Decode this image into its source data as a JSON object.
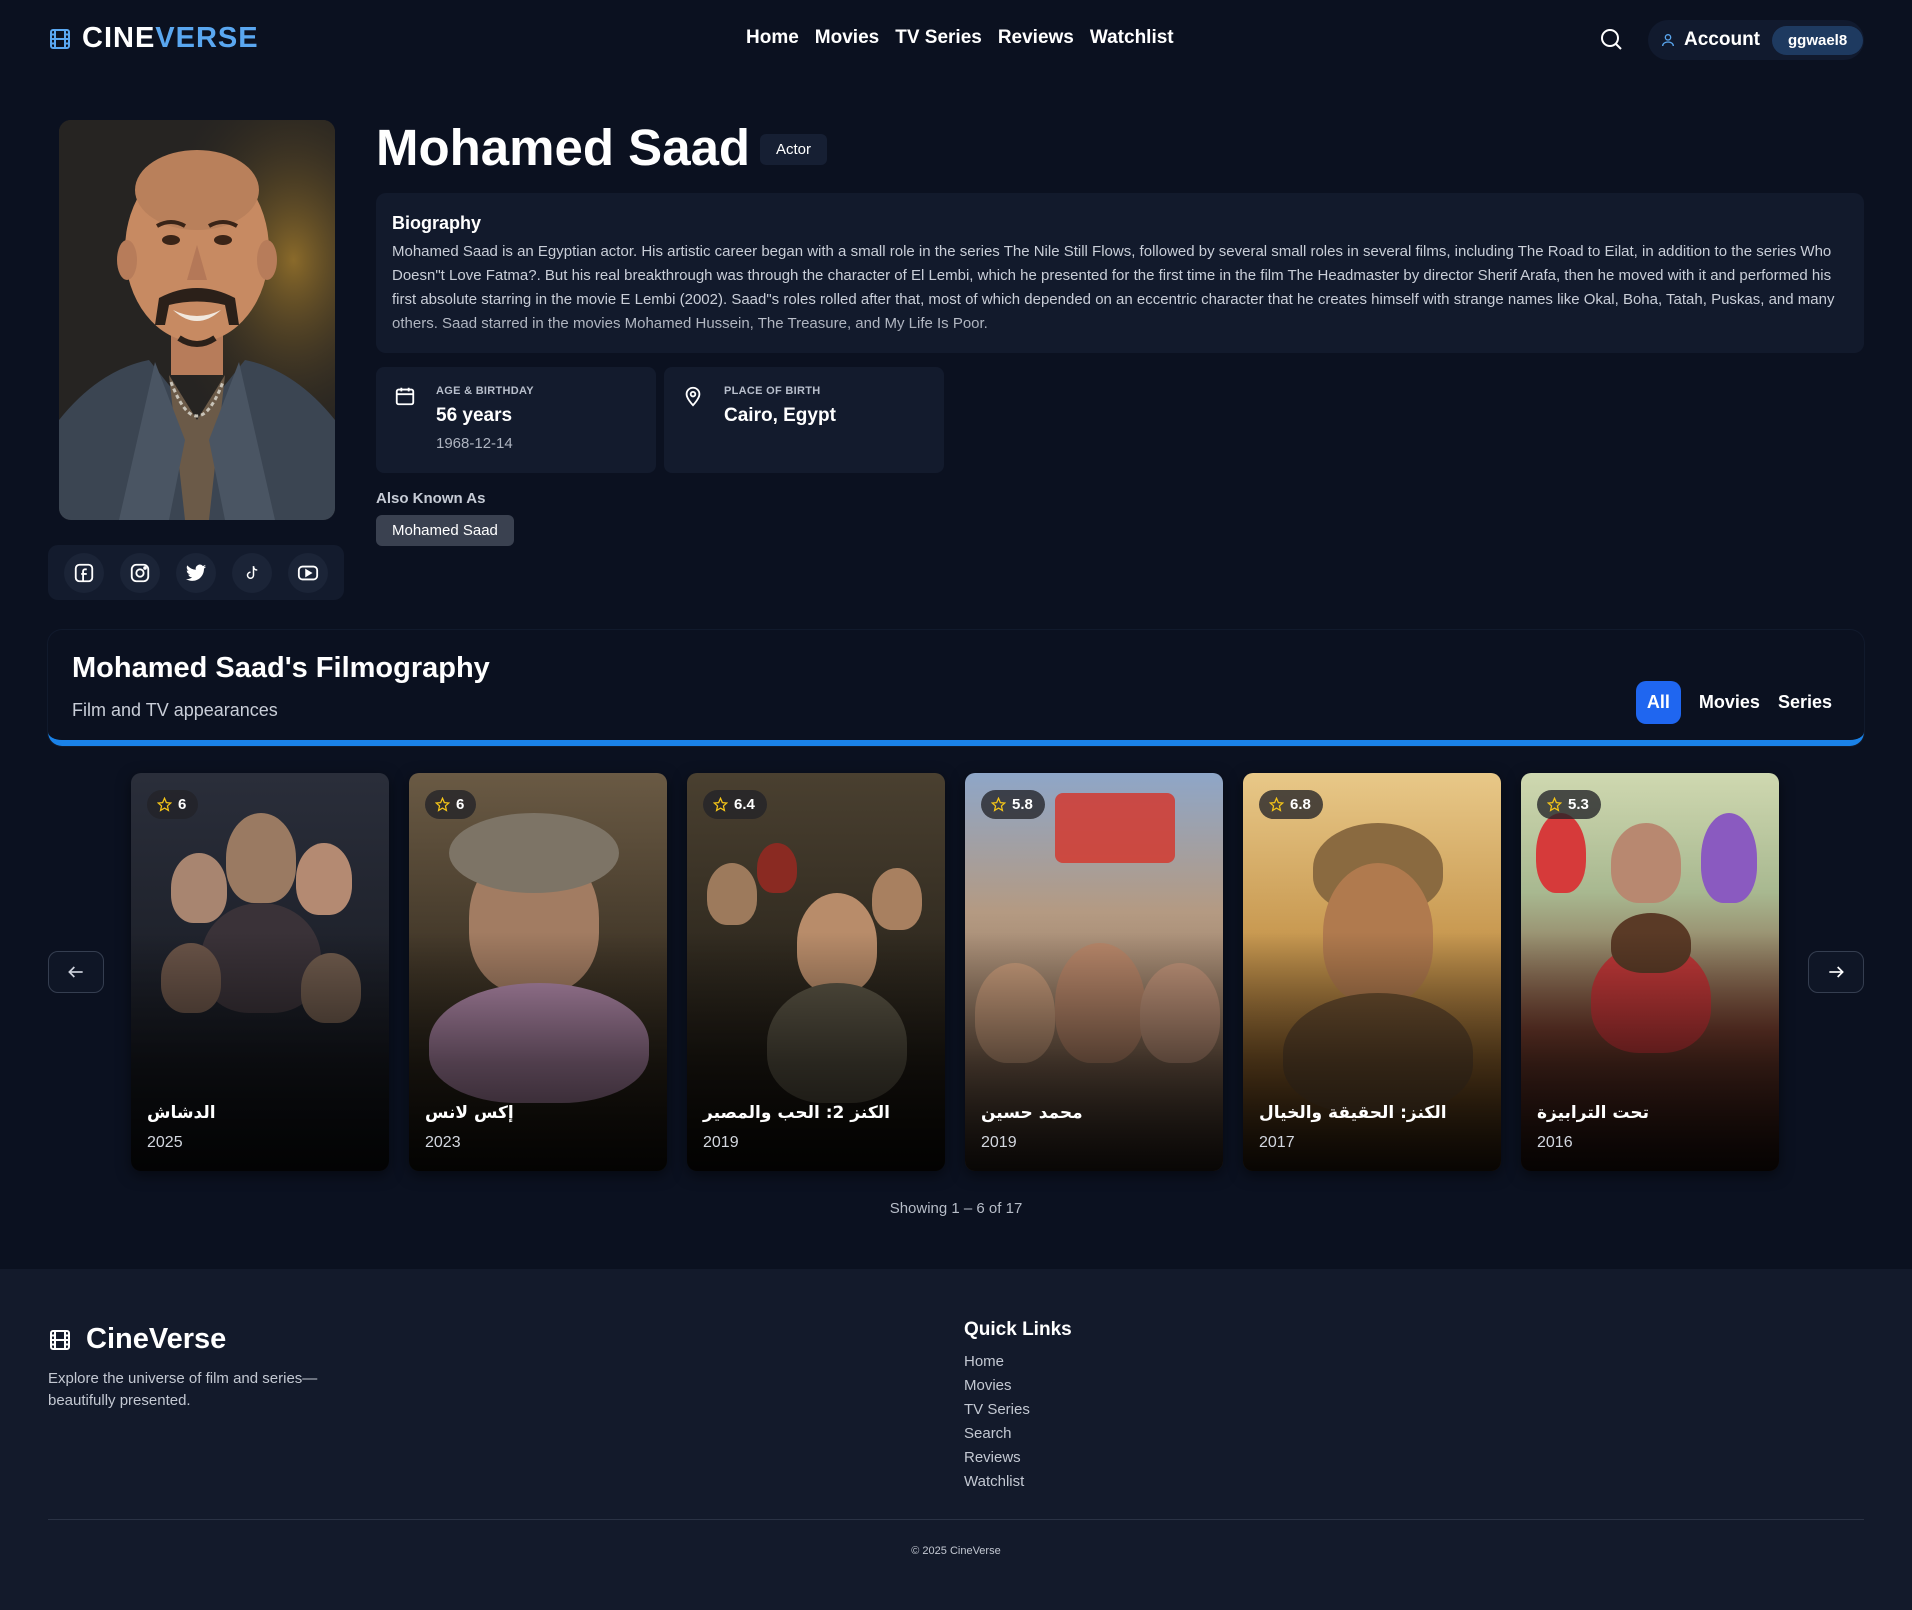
{
  "brand": {
    "part1": "CINE",
    "part2": "VERSE",
    "accent": "#5aa7f0"
  },
  "nav": {
    "items": [
      "Home",
      "Movies",
      "TV Series",
      "Reviews",
      "Watchlist"
    ]
  },
  "header": {
    "search_icon": "search-icon",
    "account_label": "Account",
    "username": "ggwael8"
  },
  "person": {
    "name": "Mohamed Saad",
    "role": "Actor",
    "bio_title": "Biography",
    "bio": "Mohamed Saad is an Egyptian actor. His artistic career began with a small role in the series The Nile Still Flows, followed by several small roles in several films, including The Road to Eilat, in addition to the series Who Doesn\"t Love Fatma?. But his real breakthrough was through the character of El Lembi, which he presented for the first time in the film The Headmaster by director Sherif Arafa, then he moved with it and performed his first absolute starring in the movie E Lembi (2002). Saad\"s roles rolled after that, most of which depended on an eccentric character that he creates himself with strange names like Okal, Boha, Tatah, Puskas, and many others. Saad starred in the movies Mohamed Hussein, The Treasure, and My Life Is Poor.",
    "age_label": "AGE & BIRTHDAY",
    "age_value": "56 years",
    "birthday": "1968-12-14",
    "birthplace_label": "PLACE OF BIRTH",
    "birthplace": "Cairo, Egypt",
    "aka_label": "Also Known As",
    "aka": [
      "Mohamed Saad"
    ],
    "socials": [
      "facebook-icon",
      "instagram-icon",
      "twitter-icon",
      "tiktok-icon",
      "youtube-icon"
    ]
  },
  "filmography": {
    "title": "Mohamed Saad's Filmography",
    "subtitle": "Film and TV appearances",
    "tabs": [
      "All",
      "Movies",
      "Series"
    ],
    "active_tab": "All",
    "accent": "#1a82e8",
    "items": [
      {
        "title": "الدشاش",
        "year": "2025",
        "rating": "6"
      },
      {
        "title": "إكس لانس",
        "year": "2023",
        "rating": "6"
      },
      {
        "title": "الكنز 2: الحب والمصير",
        "year": "2019",
        "rating": "6.4"
      },
      {
        "title": "محمد حسين",
        "year": "2019",
        "rating": "5.8"
      },
      {
        "title": "الكنز: الحقيقة والخيال",
        "year": "2017",
        "rating": "6.8"
      },
      {
        "title": "تحت الترابيزة",
        "year": "2016",
        "rating": "5.3"
      }
    ],
    "showing": "Showing 1 – 6 of 17"
  },
  "footer": {
    "brand": "CineVerse",
    "tagline": "Explore the universe of film and series—beautifully presented.",
    "quick_links_title": "Quick Links",
    "links": [
      "Home",
      "Movies",
      "TV Series",
      "Search",
      "Reviews",
      "Watchlist"
    ],
    "copyright": "© 2025 CineVerse"
  }
}
